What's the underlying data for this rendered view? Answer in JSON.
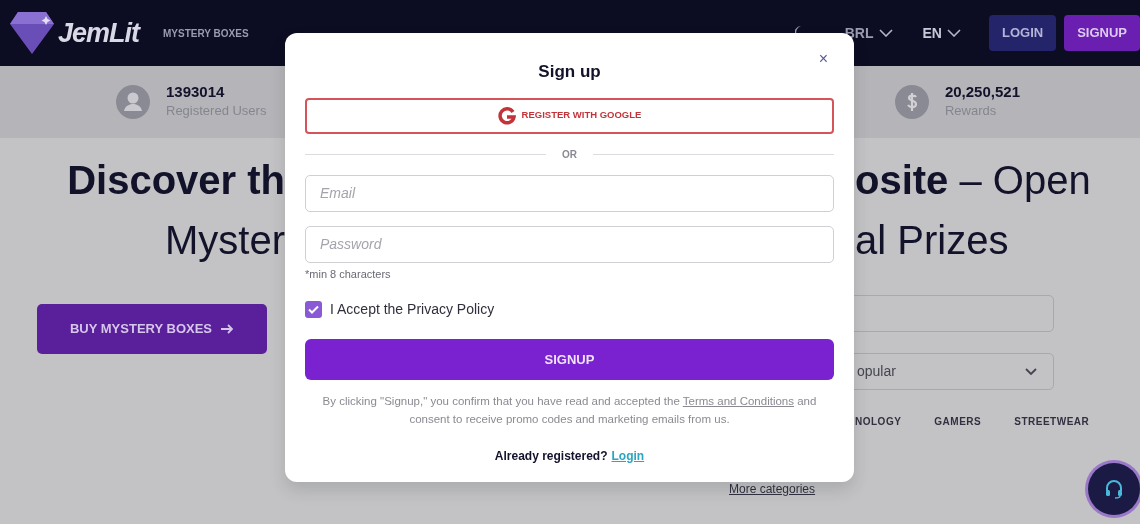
{
  "header": {
    "logo": "JemLit",
    "nav": [
      "MYSTERY BOXES"
    ],
    "currency": "BRL",
    "language": "EN",
    "buttons": [
      {
        "label": "LOGIN",
        "kind": "outline"
      },
      {
        "label": "SIGNUP",
        "kind": "solid"
      }
    ]
  },
  "stats": [
    {
      "value": "1393014",
      "label": "Registered Users",
      "kind": "user"
    },
    {
      "value": "20,250,521",
      "label": "Rewards",
      "kind": "dollar"
    }
  ],
  "hero": {
    "line_1_left": "Discover th",
    "line_1_right": "**osite** – Open",
    "line_2_left": "Myster",
    "line_2_right": "al Prizes",
    "button": "BUY MYSTERY BOXES"
  },
  "filters": {
    "select_value": "opular",
    "categories": [
      "NOLOGY",
      "GAMERS",
      "STREETWEAR"
    ],
    "more_link": "More categories"
  },
  "modal": {
    "title": "Sign up",
    "close": "×",
    "google_button": "REGISTER WITH GOOGLE",
    "divider": "OR",
    "email": {
      "placeholder": "Email"
    },
    "password": {
      "placeholder": "Password"
    },
    "hint": "*min 8 characters",
    "accept": {
      "label": "I Accept the Privacy Policy",
      "checked": true
    },
    "submit": "SIGNUP",
    "terms_before": "By clicking \"Signup,\" you confirm that you have read and accepted the",
    "terms_link": "Terms and Conditions",
    "terms_after": "and consent to receive promo codes and marketing emails from us.",
    "already": "Already registered?",
    "login_link": "Login"
  }
}
